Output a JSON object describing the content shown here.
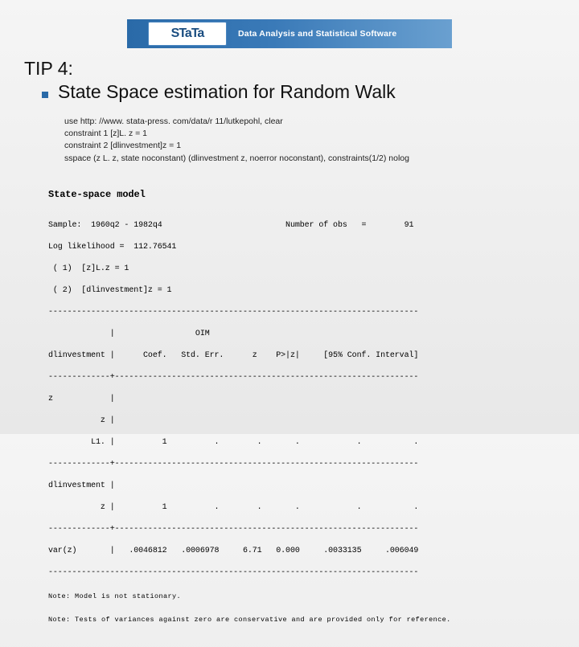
{
  "logo": {
    "brand": "STaTa",
    "tagline": "Data Analysis and Statistical Software"
  },
  "tip": "TIP 4:",
  "subtitle": "State Space estimation for Random Walk",
  "code": [
    "use http: //www. stata-press. com/data/r 11/lutkepohl, clear",
    "constraint 1 [z]L. z = 1",
    "constraint 2 [dlinvestment]z  = 1",
    "sspace  (z L. z, state noconstant) (dlinvestment z, noerror noconstant), constraints(1/2) nolog"
  ],
  "out_title": "State-space model",
  "out_header": [
    "Sample:  1960q2 - 1982q4                          Number of obs   =        91",
    "Log likelihood =  112.76541",
    " ( 1)  [z]L.z = 1",
    " ( 2)  [dlinvestment]z = 1"
  ],
  "rule": "------------------------------------------------------------------------------",
  "col_head": [
    "             |                 OIM",
    "dlinvestment |      Coef.   Std. Err.      z    P>|z|     [95% Conf. Interval]"
  ],
  "sep": "-------------+----------------------------------------------------------------",
  "rows_z": [
    "z            |",
    "           z |",
    "         L1. |          1          .        .       .            .           ."
  ],
  "rows_d": [
    "dlinvestment |",
    "           z |          1          .        .       .            .           ."
  ],
  "row_var": "var(z)       |   .0046812   .0006978     6.71   0.000     .0033135     .006049",
  "notes": [
    "Note: Model is not stationary.",
    "Note: Tests of variances against zero are conservative and are provided only for reference."
  ]
}
